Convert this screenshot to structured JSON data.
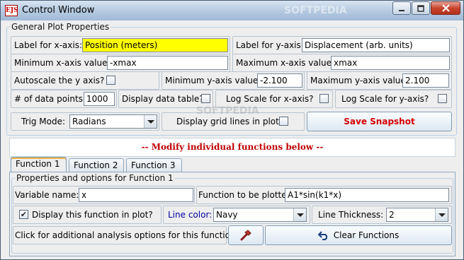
{
  "window": {
    "title": "Control Window",
    "app_icon_text": "EJS",
    "watermark": "SOFTPEDIA"
  },
  "general": {
    "legend": "General Plot Properties",
    "xlabel_label": "Label for x-axis:",
    "xlabel_value": "Position (meters)",
    "ylabel_label": "Label for y-axis:",
    "ylabel_value": "Displacement (arb. units)",
    "xmin_label": "Minimum x-axis value:",
    "xmin_value": "-xmax",
    "xmax_label": "Maximum x-axis value:",
    "xmax_value": "xmax",
    "autoscale_label": "Autoscale the y axis?",
    "autoscale_checked": false,
    "ymin_label": "Minimum y-axis value:",
    "ymin_value": "-2.100",
    "ymax_label": "Maximum y-axis value:",
    "ymax_value": "2.100",
    "npoints_label": "# of data points:",
    "npoints_value": "1000",
    "display_table_label": "Display data table?",
    "logx_label": "Log Scale for x-axis?",
    "logy_label": "Log Scale for y-axis?",
    "trig_label": "Trig Mode:",
    "trig_value": "Radians",
    "grid_label": "Display grid lines in plot?",
    "snapshot_label": "Save Snapshot",
    "snapshot_color": "#d40000"
  },
  "banner": {
    "text": "-- Modify individual functions below --",
    "color": "#c00000"
  },
  "tabs": [
    {
      "label": "Function 1",
      "active": true
    },
    {
      "label": "Function 2",
      "active": false
    },
    {
      "label": "Function 3",
      "active": false
    }
  ],
  "func": {
    "legend": "Properties and options for Function 1",
    "var_label": "Variable name:",
    "var_value": "x",
    "expr_label": "Function to be plotted:",
    "expr_value": "A1*sin(k1*x)",
    "display_label": "Display this function in plot?",
    "display_checked": true,
    "linecolor_label": "Line color:",
    "linecolor_label_color": "#0000a0",
    "linecolor_value": "Navy",
    "thickness_label": "Line Thickness:",
    "thickness_value": "2",
    "analysis_label": "Click for additional analysis options for this function:",
    "clear_label": "Clear Functions"
  }
}
